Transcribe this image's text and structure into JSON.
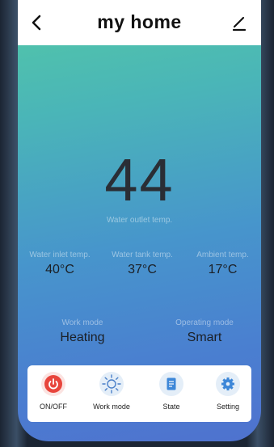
{
  "header": {
    "title": "my home"
  },
  "main_reading": {
    "value": "44",
    "label": "Water outlet temp."
  },
  "stats": [
    {
      "label": "Water inlet temp.",
      "value": "40°C"
    },
    {
      "label": "Water tank temp.",
      "value": "37°C"
    },
    {
      "label": "Ambient temp.",
      "value": "17°C"
    }
  ],
  "modes": [
    {
      "label": "Work mode",
      "value": "Heating"
    },
    {
      "label": "Operating mode",
      "value": "Smart"
    }
  ],
  "toolbar": {
    "items": [
      {
        "label": "ON/OFF",
        "icon": "power-icon",
        "color": "#e8453c"
      },
      {
        "label": "Work mode",
        "icon": "sun-icon",
        "color": "#4a7fc8"
      },
      {
        "label": "State",
        "icon": "document-icon",
        "color": "#3d87d8"
      },
      {
        "label": "Setting",
        "icon": "gear-icon",
        "color": "#3d87d8"
      }
    ]
  }
}
